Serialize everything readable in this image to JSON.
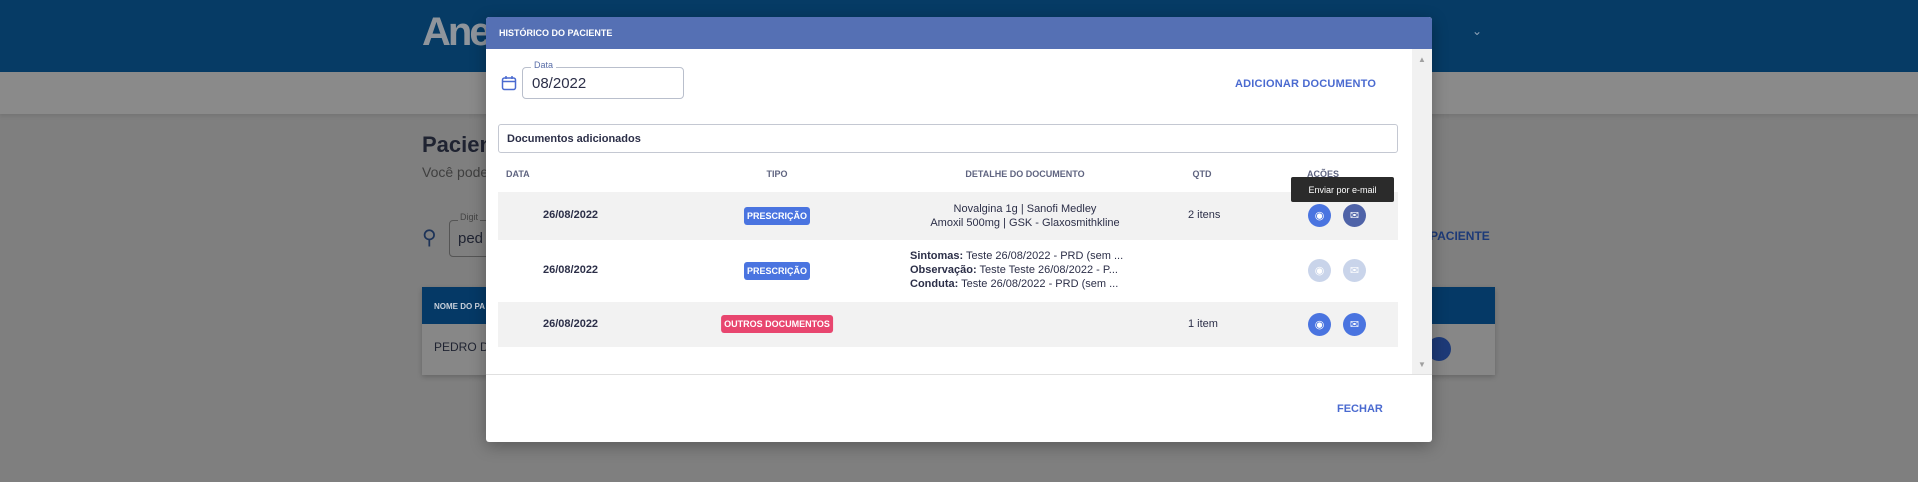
{
  "background": {
    "logo": "Ane",
    "page_title": "Pacient",
    "page_subtitle": "Você pode",
    "search_label": "Digit",
    "search_value": "ped",
    "add_link": "PACIENTE",
    "table_header": "NOME DO PA",
    "table_row": "PEDRO D"
  },
  "modal": {
    "title": "HISTÓRICO DO PACIENTE",
    "date_label": "Data",
    "date_value": "08/2022",
    "add_document": "ADICIONAR DOCUMENTO",
    "section_title": "Documentos adicionados",
    "columns": [
      "DATA",
      "TIPO",
      "DETALHE DO DOCUMENTO",
      "QTD",
      "AÇÕES"
    ],
    "rows": [
      {
        "date": "26/08/2022",
        "type": "PRESCRIÇÃO",
        "type_color": "#4a74e0",
        "details": [
          "Novalgina 1g | Sanofi Medley",
          "Amoxil 500mg | GSK - Glaxosmithkline"
        ],
        "qtd": "2 itens",
        "actions_enabled": true
      },
      {
        "date": "26/08/2022",
        "type": "PRESCRIÇÃO",
        "type_color": "#4a74e0",
        "details": [
          {
            "label": "Sintomas:",
            "text": " Teste 26/08/2022 - PRD (sem ..."
          },
          {
            "label": "Observação:",
            "text": " Teste Teste 26/08/2022 - P..."
          },
          {
            "label": "Conduta:",
            "text": " Teste 26/08/2022 - PRD (sem ..."
          }
        ],
        "qtd": "",
        "actions_enabled": false
      },
      {
        "date": "26/08/2022",
        "type": "OUTROS DOCUMENTOS",
        "type_color": "#e8466f",
        "details": [],
        "qtd": "1 item",
        "actions_enabled": true
      }
    ],
    "tooltip": "Enviar por e-mail",
    "close": "FECHAR"
  },
  "colors": {
    "header": "#063b65",
    "modal_header": "#5570b4",
    "accent": "#4a6ad0",
    "eye_button": "#4a74e0",
    "mail_button_hover": "#4f63a8",
    "disabled_button": "#c9d4ea"
  }
}
